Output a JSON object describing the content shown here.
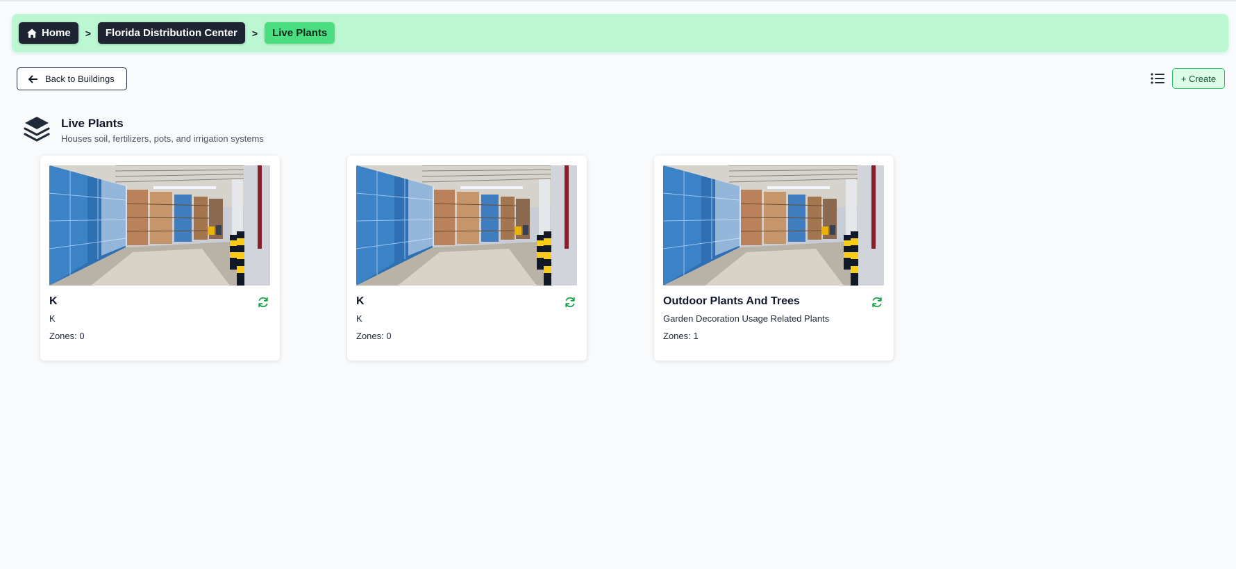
{
  "breadcrumb": {
    "home_label": "Home",
    "separator": ">",
    "building_label": "Florida Distribution Center",
    "current_label": "Live Plants"
  },
  "actions": {
    "back_label": "Back to Buildings",
    "create_label": "+ Create"
  },
  "section": {
    "title": "Live Plants",
    "description": "Houses soil, fertilizers, pots, and irrigation systems",
    "icon": "layers-icon"
  },
  "cards": [
    {
      "title": "K",
      "subtitle": "K",
      "zones_text": "Zones: 0",
      "zones": 0,
      "icon": "refresh-icon"
    },
    {
      "title": "K",
      "subtitle": "K",
      "zones_text": "Zones: 0",
      "zones": 0,
      "icon": "refresh-icon"
    },
    {
      "title": "Outdoor Plants And Trees",
      "subtitle": "Garden Decoration Usage Related Plants",
      "zones_text": "Zones: 1",
      "zones": 1,
      "icon": "refresh-icon"
    }
  ],
  "colors": {
    "breadcrumb_bar": "#bbf7d0",
    "breadcrumb_dark": "#1f2433",
    "breadcrumb_active": "#4ade80",
    "create_border": "#22c55e",
    "create_bg": "#dcfce7",
    "sync_icon": "#16a34a"
  }
}
